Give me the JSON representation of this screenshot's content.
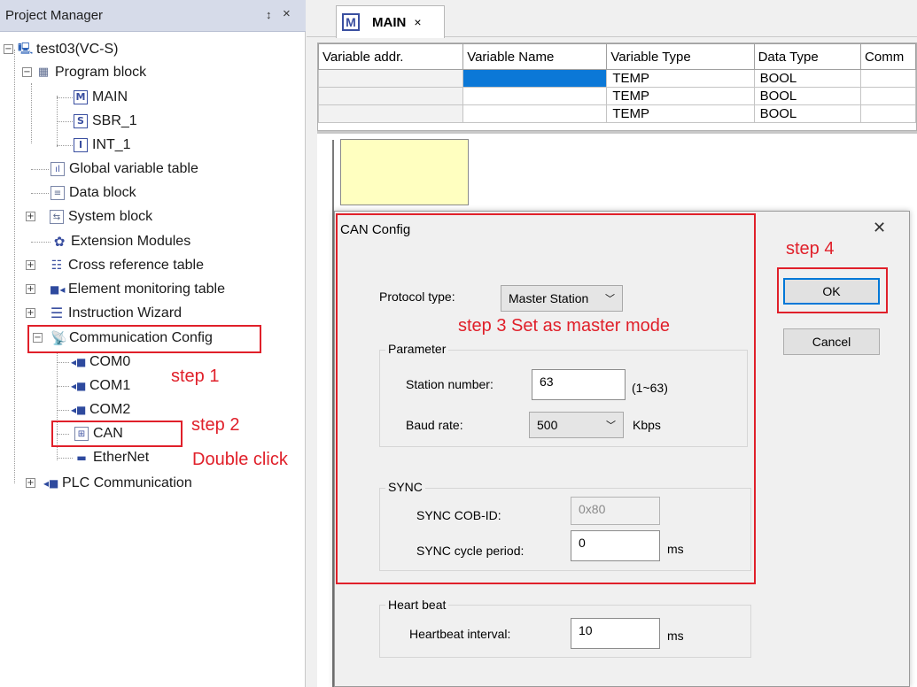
{
  "project_manager": {
    "title": "Project Manager",
    "pin_glyph": "↕",
    "close_glyph": "×",
    "tree": {
      "project": "test03(VC-S)",
      "program_block": "Program block",
      "main": "MAIN",
      "sbr": "SBR_1",
      "int": "INT_1",
      "global_var_table": "Global variable table",
      "data_block": "Data block",
      "system_block": "System block",
      "extension_modules": "Extension Modules",
      "cross_reference_table": "Cross reference table",
      "element_monitoring_table": "Element monitoring table",
      "instruction_wizard": "Instruction Wizard",
      "communication_config": "Communication Config",
      "com0": "COM0",
      "com1": "COM1",
      "com2": "COM2",
      "can": "CAN",
      "ethernet": "EtherNet",
      "plc_communication": "PLC Communication"
    }
  },
  "editor": {
    "tab_label": "MAIN",
    "tab_icon": "M",
    "tab_close": "×",
    "var_table": {
      "headers": [
        "Variable addr.",
        "Variable Name",
        "Variable Type",
        "Data Type",
        "Comm"
      ],
      "rows": [
        [
          "",
          "",
          "TEMP",
          "BOOL",
          ""
        ],
        [
          "",
          "",
          "TEMP",
          "BOOL",
          ""
        ],
        [
          "",
          "",
          "TEMP",
          "BOOL",
          ""
        ]
      ]
    }
  },
  "dialog": {
    "title": "CAN Config",
    "close_glyph": "✕",
    "protocol_type_label": "Protocol type:",
    "protocol_type_value": "Master Station",
    "parameter_group": "Parameter",
    "station_number_label": "Station number:",
    "station_number_value": "63",
    "station_number_range": "(1~63)",
    "baud_rate_label": "Baud rate:",
    "baud_rate_value": "500",
    "baud_rate_unit": "Kbps",
    "sync_group": "SYNC",
    "sync_cob_label": "SYNC  COB-ID:",
    "sync_cob_value": "0x80",
    "sync_cycle_label": "SYNC cycle period:",
    "sync_cycle_value": "0",
    "sync_cycle_unit": "ms",
    "heartbeat_group": "Heart beat",
    "heartbeat_label": "Heartbeat interval:",
    "heartbeat_value": "10",
    "heartbeat_unit": "ms",
    "ok_label": "OK",
    "cancel_label": "Cancel"
  },
  "annotations": {
    "step1": "step 1",
    "step2": "step 2",
    "step2_sub": "Double click",
    "step3": "step 3 Set as master mode",
    "step4": "step 4",
    "color": "#e0202a"
  }
}
